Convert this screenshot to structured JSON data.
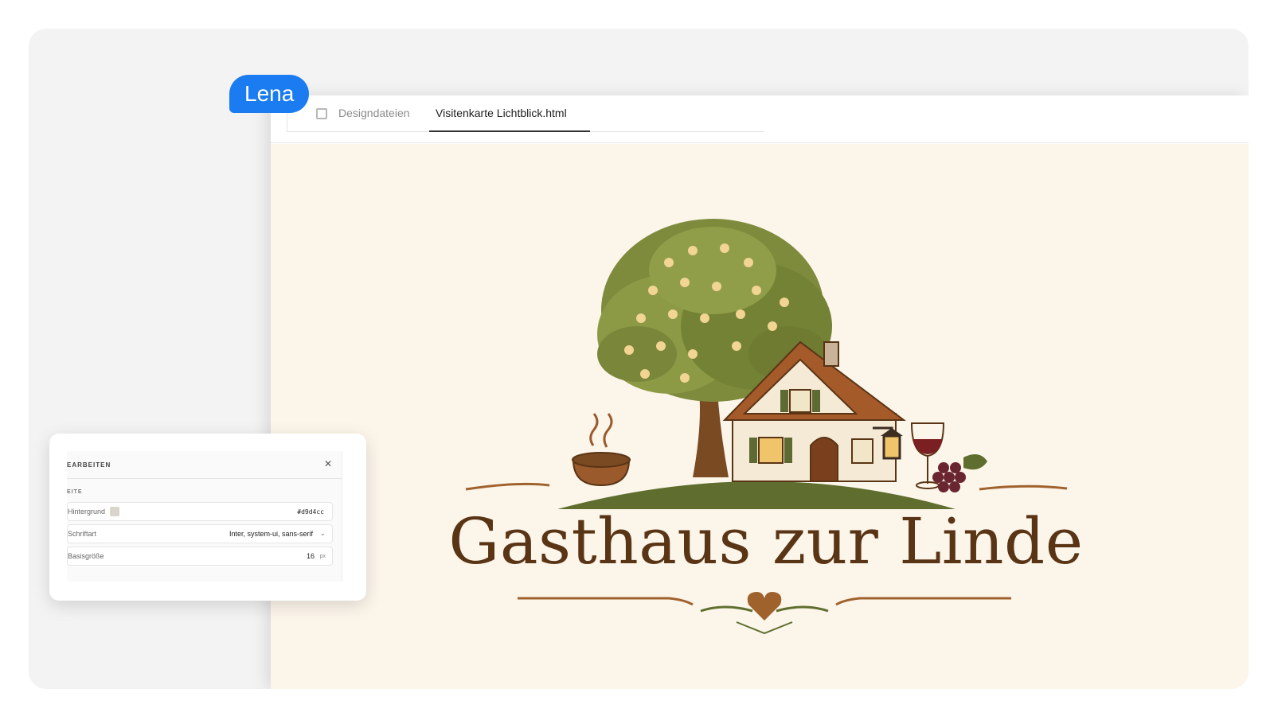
{
  "tabs": [
    {
      "label": "Designdateien"
    },
    {
      "label": "Visitenkarte Lichtblick.html"
    }
  ],
  "collaborator": {
    "name": "Lena",
    "color": "#1a7cf0"
  },
  "canvas": {
    "background": "#fcf5ea"
  },
  "logo": {
    "title": "Gasthaus zur Linde",
    "title_color": "#5a3515"
  },
  "panel": {
    "title": "EARBEITEN",
    "close_icon": "close-icon",
    "section": "EITE",
    "rows": [
      {
        "label": "Hintergrund",
        "value": "#d9d4cc",
        "swatch": "#d9d4cc"
      },
      {
        "label": "Schriftart",
        "value": "Inter, system-ui, sans-serif"
      },
      {
        "label": "Basisgröße",
        "value": "16",
        "unit": "px"
      }
    ]
  }
}
